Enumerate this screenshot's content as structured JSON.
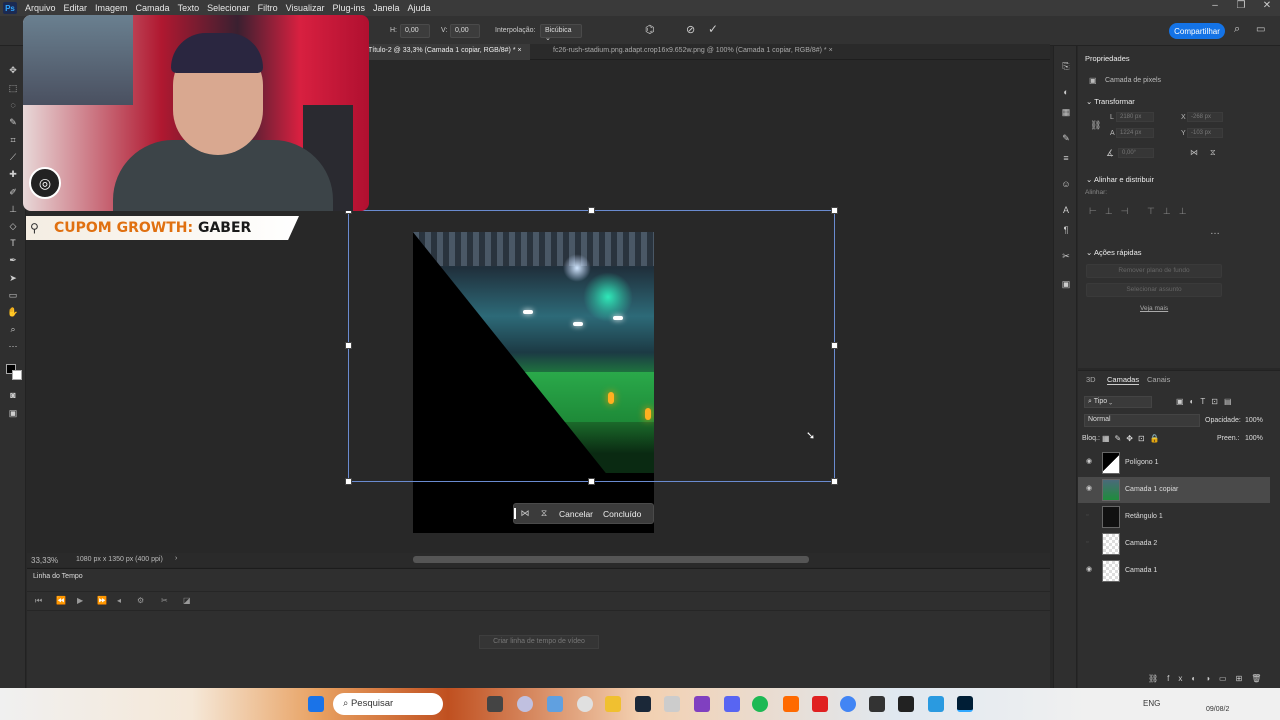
{
  "app": {
    "name": "Ps"
  },
  "menu": [
    "Arquivo",
    "Editar",
    "Imagem",
    "Camada",
    "Texto",
    "Selecionar",
    "Filtro",
    "Visualizar",
    "Plug-ins",
    "Janela",
    "Ajuda"
  ],
  "options": {
    "h_label": "H:",
    "h_value": "0,00",
    "v_label": "V:",
    "v_value": "0,00",
    "interp_label": "Interpolação:",
    "interp_value": "Bicúbica",
    "share": "Compartilhar"
  },
  "tabs": [
    {
      "label": "Título-2 @ 33,3% (Camada 1 copiar, RGB/8#) *"
    },
    {
      "label": "fc26-rush-stadium.png.adapt.crop16x9.652w.png @ 100% (Camada 1 copiar, RGB/8#) *"
    }
  ],
  "context_bar": {
    "cancel": "Cancelar",
    "done": "Concluído"
  },
  "status": {
    "zoom": "33,33%",
    "doc_info": "1080 px x 1350 px (400 ppi)"
  },
  "timeline": {
    "title": "Linha do Tempo",
    "create": "Criar linha de tempo de vídeo"
  },
  "properties": {
    "title": "Propriedades",
    "kind": "Camada de pixels",
    "transform": "Transformar",
    "w_label": "L",
    "w_value": "2180 px",
    "x_label": "X",
    "x_value": "-268 px",
    "h_label": "A",
    "h_value": "1224 px",
    "y_label": "Y",
    "y_value": "-103 px",
    "angle_value": "0,00°",
    "align_section": "Alinhar e distribuir",
    "align_label": "Alinhar:",
    "quick_actions": "Ações rápidas",
    "remove_bg": "Remover plano de fundo",
    "select_subject": "Selecionar assunto",
    "see_more": "Veja mais"
  },
  "layers_panel": {
    "tabs": [
      "3D",
      "Camadas",
      "Canais"
    ],
    "filter": "Tipo",
    "blend": "Normal",
    "opacity_label": "Opacidade:",
    "opacity": "100%",
    "lock_label": "Bloq.:",
    "fill_label": "Preen.:",
    "fill": "100%",
    "layers": [
      {
        "name": "Polígono 1",
        "visible": true
      },
      {
        "name": "Camada 1 copiar",
        "visible": true,
        "selected": true
      },
      {
        "name": "Retângulo 1",
        "visible": false
      },
      {
        "name": "Camada 2",
        "visible": false
      },
      {
        "name": "Camada 1",
        "visible": true
      }
    ]
  },
  "overlay": {
    "coupon_prefix": "CUPOM GROWTH:",
    "coupon_code": "GABER"
  },
  "taskbar": {
    "search": "Pesquisar",
    "lang": "ENG",
    "date": "09/08/2"
  },
  "colors": {
    "accent": "#1473e6",
    "selection": "#6a8bd0"
  }
}
